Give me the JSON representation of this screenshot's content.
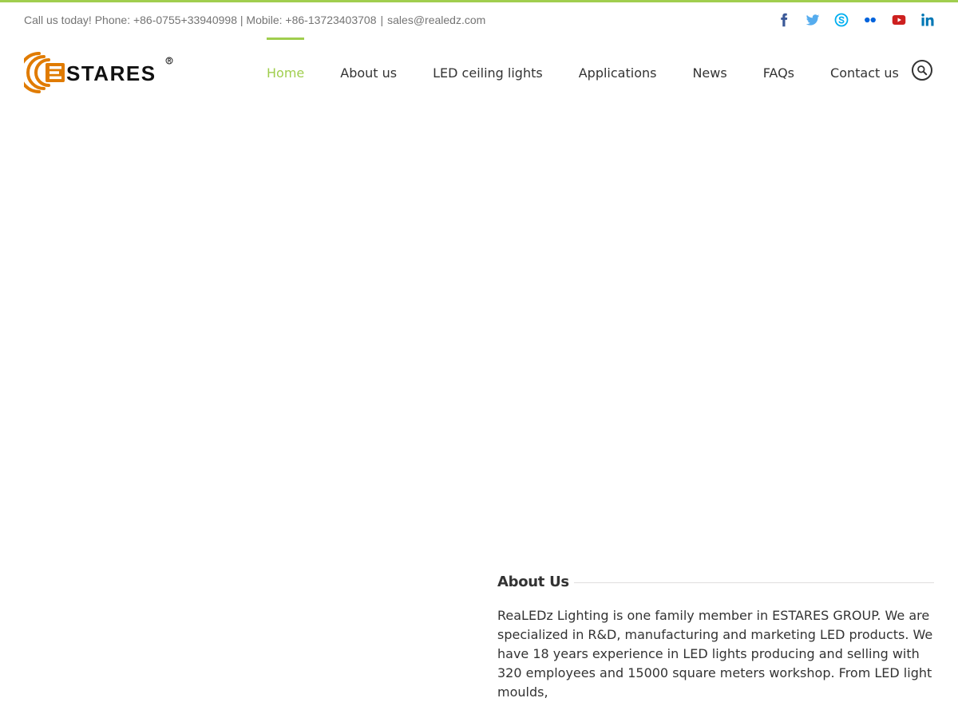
{
  "topbar": {
    "phone": "Call us today! Phone: +86-0755+33940998 | Mobile: +86-13723403708",
    "separator": "|",
    "email": "sales@realedz.com",
    "socials": [
      {
        "name": "facebook-icon",
        "color": "#3b5998"
      },
      {
        "name": "twitter-icon",
        "color": "#55acee"
      },
      {
        "name": "skype-icon",
        "color": "#00aff0"
      },
      {
        "name": "flickr-icon",
        "color": "#0063dc"
      },
      {
        "name": "youtube-icon",
        "color": "#cd201f"
      },
      {
        "name": "linkedin-icon",
        "color": "#0077b5"
      }
    ]
  },
  "brand": {
    "logo_text": "STARES",
    "logo_color": "#e07b00"
  },
  "nav": {
    "items": [
      {
        "label": "Home",
        "active": true
      },
      {
        "label": "About us"
      },
      {
        "label": "LED ceiling lights"
      },
      {
        "label": "Applications"
      },
      {
        "label": "News"
      },
      {
        "label": "FAQs"
      },
      {
        "label": "Contact us"
      }
    ],
    "search_icon": "search-icon",
    "accent_color": "#a0ce4e"
  },
  "about": {
    "title": "About Us",
    "text": "ReaLEDz Lighting is one family member in ESTARES GROUP. We are specialized in R&D, manufacturing and marketing LED products. We have 18 years experience in LED lights producing and selling with 320 employees and 15000 square meters workshop. From LED light moulds,"
  }
}
